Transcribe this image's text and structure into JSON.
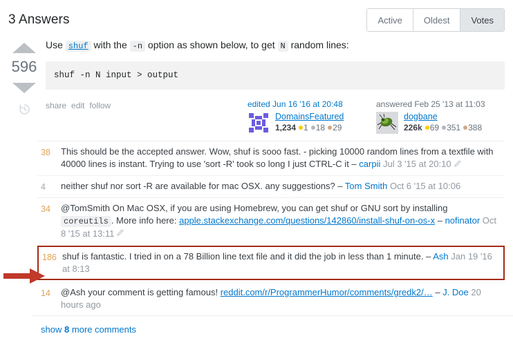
{
  "header": {
    "title": "3 Answers",
    "sort_tabs": [
      {
        "label": "Active",
        "selected": false
      },
      {
        "label": "Oldest",
        "selected": false
      },
      {
        "label": "Votes",
        "selected": true
      }
    ]
  },
  "answer": {
    "vote_count": "596",
    "body": {
      "text_part1": "Use ",
      "code_link": "shuf",
      "text_part2": " with the ",
      "code_n": "-n",
      "text_part3": " option as shown below, to get ",
      "code_N": "N",
      "text_part4": " random lines:",
      "codeblock": "shuf -n N input > output"
    },
    "actions": {
      "share": "share",
      "edit": "edit",
      "follow": "follow"
    },
    "editor": {
      "action_text": "edited Jun 16 '16 at 20:48",
      "name": "DomainsFeatured",
      "reputation": "1,234",
      "gold": "1",
      "silver": "18",
      "bronze": "29"
    },
    "author": {
      "action_text": "answered Feb 25 '13 at 11:03",
      "name": "dogbane",
      "reputation": "226k",
      "gold": "69",
      "silver": "351",
      "bronze": "388"
    }
  },
  "comments": [
    {
      "score": "38",
      "score_low": false,
      "text": "This should be the accepted answer. Wow, shuf is sooo fast. - picking 10000 random lines from a textfile with 40000 lines is instant. Trying to use 'sort -R' took so long I just CTRL-C it",
      "dash": " – ",
      "user": "carpii",
      "date": "Jul 3 '15 at 20:10",
      "has_pencil": true,
      "highlight": false
    },
    {
      "score": "4",
      "score_low": true,
      "text": "neither shuf nor sort -R are available for mac OSX. any suggestions?",
      "dash": " – ",
      "user": "Tom Smith",
      "date": "Oct 6 '15 at 10:06",
      "has_pencil": false,
      "highlight": false
    },
    {
      "score": "34",
      "score_low": false,
      "text_before_code": "@TomSmith On Mac OSX, if you are using Homebrew, you can get shuf or GNU sort by installing ",
      "code": "coreutils",
      "text_after_code": ". More info here: ",
      "link": "apple.stackexchange.com/questions/142860/install-shuf-on-os-x",
      "dash": " – ",
      "user": "nofinator",
      "date": "Oct 8 '15 at 13:11",
      "has_pencil": true,
      "highlight": false
    },
    {
      "score": "186",
      "score_low": false,
      "text": "shuf is fantastic. I tried in on a 78 Billion line text file and it did the job in less than 1 minute.",
      "dash": " – ",
      "user": "Ash",
      "date": "Jan 19 '16 at 8:13",
      "has_pencil": false,
      "highlight": true
    },
    {
      "score": "14",
      "score_low": false,
      "text_before_link": "@Ash your comment is getting famous! ",
      "link": "reddit.com/r/ProgrammerHumor/comments/gredk2/…",
      "dash": " – ",
      "user": "J. Doe",
      "date": "20 hours ago",
      "has_pencil": false,
      "highlight": false
    }
  ],
  "footer": {
    "show_prefix": "show ",
    "show_count": "8",
    "show_suffix": " more comments"
  },
  "colors": {
    "link": "#0077cc",
    "score": "#e0a458",
    "highlight_border": "#a52a15",
    "arrow": "#c0392b"
  }
}
